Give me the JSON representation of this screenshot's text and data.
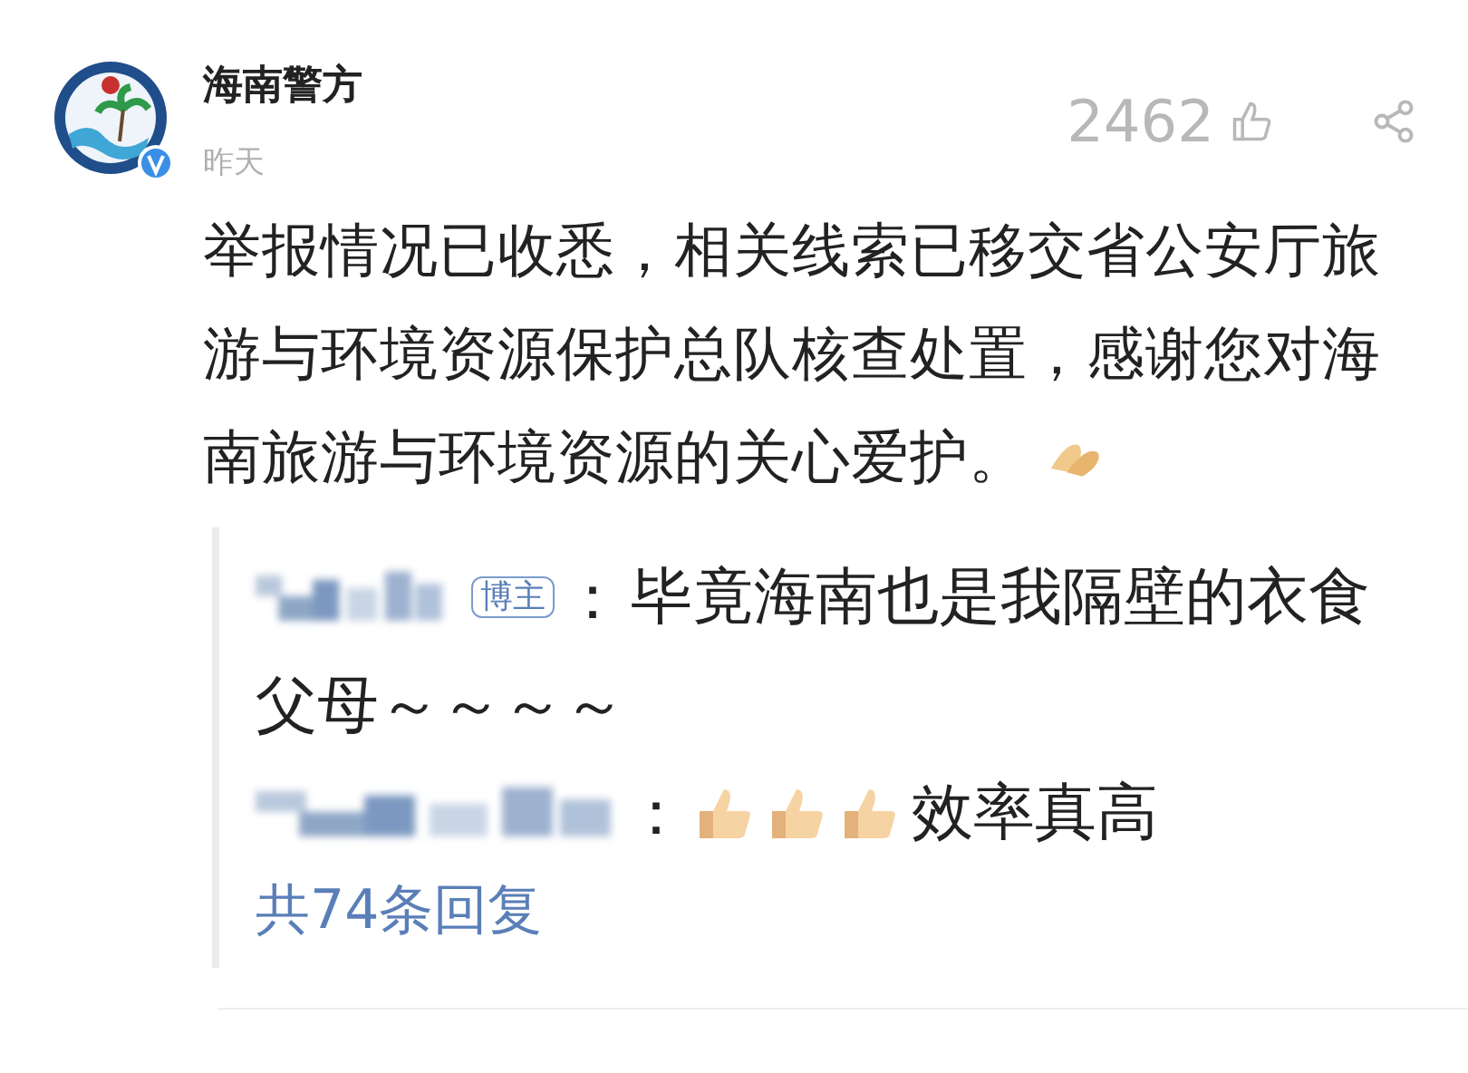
{
  "post": {
    "author": "海南警方",
    "verified": true,
    "time": "昨天",
    "likes": "2462",
    "text": "举报情况已收悉，相关线索已移交省公安厅旅游与环境资源保护总队核查处置，感谢您对海南旅游与环境资源的关心爱护。"
  },
  "replies": [
    {
      "kind": "author",
      "badge": "博主",
      "separator": "：",
      "lines": [
        "毕竟海南也是我隔壁的衣食",
        "父母～～～～"
      ]
    },
    {
      "kind": "thumbs",
      "separator": "：",
      "text": "效率真高"
    }
  ],
  "reply_count": "共74条回复"
}
